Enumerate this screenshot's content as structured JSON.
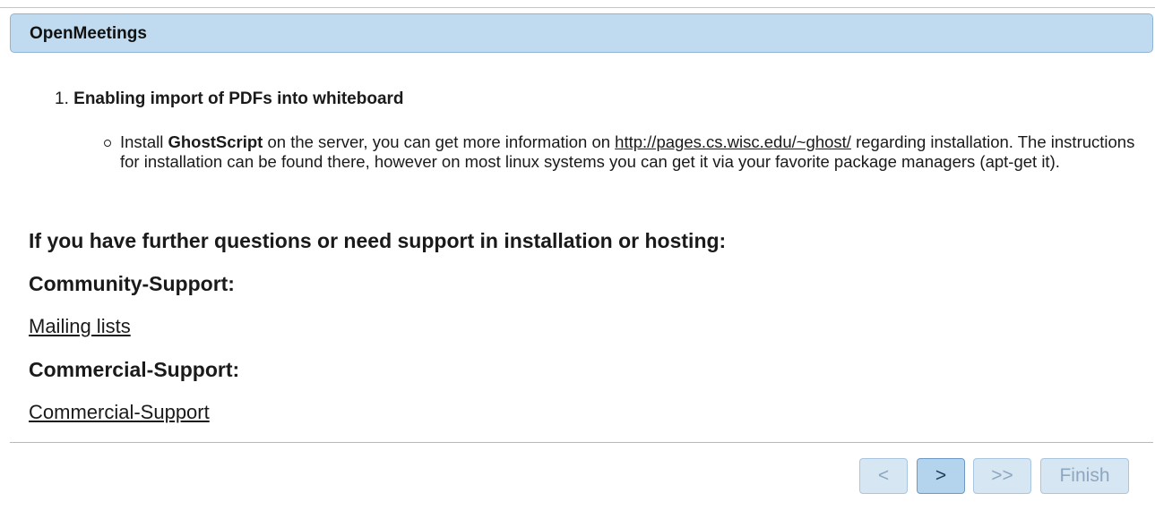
{
  "header": {
    "title": "OpenMeetings"
  },
  "steps": [
    {
      "number": "1.",
      "title": "Enabling import of PDFs into whiteboard",
      "bullet": {
        "prefix": "Install ",
        "bold": "GhostScript",
        "middle": " on the server, you can get more information on ",
        "link": "http://pages.cs.wisc.edu/~ghost/",
        "suffix": " regarding installation. The instructions for installation can be found there, however on most linux systems you can get it via your favorite package managers (apt-get it)."
      }
    }
  ],
  "support": {
    "heading": "If you have further questions or need support in installation or hosting:",
    "community_heading": "Community-Support:",
    "community_link": "Mailing lists",
    "commercial_heading": "Commercial-Support:",
    "commercial_link": "Commercial-Support"
  },
  "buttons": {
    "prev": "<",
    "next": ">",
    "last": ">>",
    "finish": "Finish"
  },
  "colors": {
    "header_bg": "#c0dbef",
    "button_active_bg": "#b4d3ec",
    "button_disabled_bg": "#d6e6f3"
  }
}
